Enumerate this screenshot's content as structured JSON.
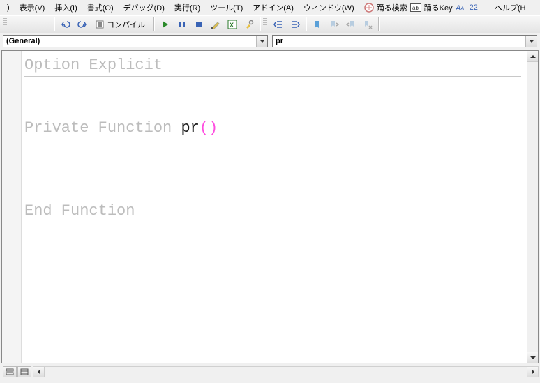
{
  "menubar": {
    "items": [
      {
        "label": "表示(V)",
        "u": "V"
      },
      {
        "label": "挿入(I)",
        "u": "I"
      },
      {
        "label": "書式(O)",
        "u": "O"
      },
      {
        "label": "デバッグ(D)",
        "u": "D"
      },
      {
        "label": "実行(R)",
        "u": "R"
      },
      {
        "label": "ツール(T)",
        "u": "T"
      },
      {
        "label": "アドイン(A)",
        "u": "A"
      },
      {
        "label": "ウィンドウ(W)",
        "u": "W"
      }
    ],
    "extra": {
      "search_label": "踊る検索",
      "key_label": "踊るKey",
      "font_size": "22",
      "help_label": "ヘルプ(H"
    }
  },
  "toolbar": {
    "compile_label": "コンパイル"
  },
  "dropdowns": {
    "scope": "(General)",
    "proc": "pr"
  },
  "code": {
    "line1": "Option Explicit",
    "line3_kw1": "Private",
    "line3_kw2": "Function",
    "line3_name": "pr",
    "line3_paren": "()",
    "line7": "End Function"
  },
  "icons": {
    "undo": "undo-icon",
    "redo": "redo-icon",
    "compile": "compile-icon",
    "run": "play-icon",
    "pause": "pause-icon",
    "stop": "stop-icon",
    "toggle": "toggle-breakpoint-icon",
    "xls": "excel-icon",
    "tool": "tool-icon",
    "indent": "indent-icon",
    "outdent": "outdent-icon",
    "tag1": "tag-icon",
    "tag2": "tag-next-icon",
    "tag3": "tag-prev-icon",
    "tag4": "tag-clear-icon"
  }
}
